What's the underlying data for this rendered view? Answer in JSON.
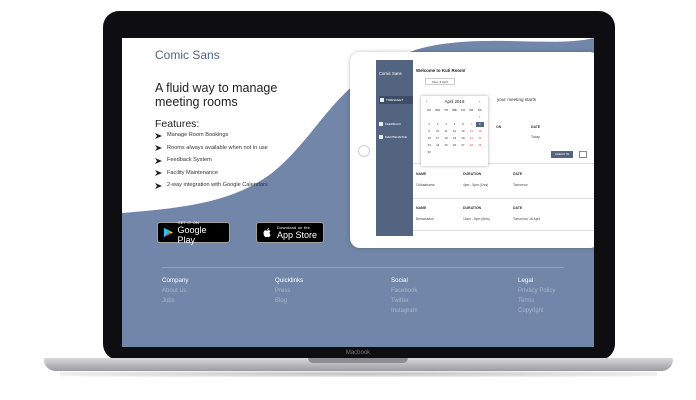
{
  "laptop": {
    "label": "Macbook"
  },
  "hero": {
    "brand": "Comic Sans",
    "headline": "A fluid way to manage meeting rooms",
    "features_title": "Features:",
    "features": [
      "Manage Room Bookings",
      "Rooms always available when not in use",
      "Feedback System",
      "Facility Maintenance",
      "2-way integration with Google Calendars"
    ]
  },
  "stores": {
    "google": {
      "small": "GET IT ON",
      "big": "Google Play"
    },
    "apple": {
      "small": "Download on the",
      "big": "App Store"
    }
  },
  "app_mock": {
    "sidebar_title": "Comic Sans",
    "nav": [
      {
        "label": "TIMESHEET"
      },
      {
        "label": "FEEDBACK"
      },
      {
        "label": "MAINTENANCE"
      }
    ],
    "welcome": "Welcome to Kuti Room!",
    "date_pill": "Mon, 8 April",
    "meeting_text": "your meeting starts",
    "col_headers": {
      "name": "NAME",
      "duration": "DURATION",
      "date": "DATE",
      "on": "ON"
    },
    "checkin_label": "CHECK IN",
    "today": "Today",
    "rows": [
      {
        "name": "Chikaabama",
        "duration": "4pm - 5pm (1hrs)",
        "date": "Tomorrow"
      },
      {
        "name": "Bemanadoh",
        "duration": "11am - 5pm (6hrs)",
        "date": "Tomorrow, 16 April"
      }
    ],
    "calendar": {
      "month": "April 2018",
      "prev": "‹",
      "next": "›",
      "days": [
        "SU",
        "MO",
        "TU",
        "WE",
        "TH",
        "FR",
        "SA"
      ],
      "cells": [
        "",
        "",
        "",
        "",
        "",
        "",
        "1",
        "2",
        "3",
        "4",
        "5",
        "6",
        "7",
        "8",
        "9",
        "10",
        "11",
        "12",
        "13",
        "14",
        "15",
        "16",
        "17",
        "18",
        "19",
        "20",
        "21",
        "22",
        "23",
        "24",
        "25",
        "26",
        "27",
        "28",
        "29",
        "30",
        "",
        "",
        "",
        "",
        "",
        ""
      ]
    }
  },
  "footer": {
    "columns": [
      {
        "heading": "Company",
        "links": [
          "About Us",
          "Jobs"
        ]
      },
      {
        "heading": "Quicklinks",
        "links": [
          "Press",
          "Blog"
        ]
      },
      {
        "heading": "Social",
        "links": [
          "Facebook",
          "Twitter",
          "Instagram"
        ]
      },
      {
        "heading": "Legal",
        "links": [
          "Privacy Policy",
          "Terms",
          "Copyright"
        ]
      }
    ]
  },
  "colors": {
    "brand": "#4c648f",
    "footer_bg": "#7186a8",
    "sidebar": "#52647f"
  }
}
